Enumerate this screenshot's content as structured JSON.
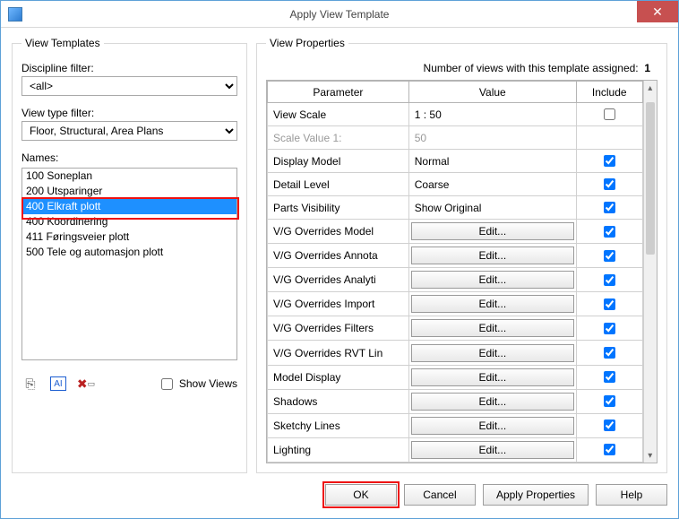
{
  "window": {
    "title": "Apply View Template"
  },
  "left": {
    "group_label": "View Templates",
    "discipline_label": "Discipline filter:",
    "discipline_value": "<all>",
    "viewtype_label": "View type filter:",
    "viewtype_value": "Floor, Structural, Area Plans",
    "names_label": "Names:",
    "names": [
      {
        "text": "100 Soneplan",
        "selected": false
      },
      {
        "text": "200 Utsparinger",
        "selected": false
      },
      {
        "text": "400 Elkraft plott",
        "selected": true
      },
      {
        "text": "400 Koordinering",
        "selected": false
      },
      {
        "text": "411 Føringsveier plott",
        "selected": false
      },
      {
        "text": "500 Tele og automasjon plott",
        "selected": false
      }
    ],
    "show_views_label": "Show Views"
  },
  "right": {
    "group_label": "View Properties",
    "assigned_prefix": "Number of views with this template assigned:",
    "assigned_count": "1",
    "columns": {
      "parameter": "Parameter",
      "value": "Value",
      "include": "Include"
    },
    "edit_label": "Edit...",
    "rows": [
      {
        "param": "View Scale",
        "value_text": "1 : 50",
        "edit": false,
        "include": false,
        "disabled": false
      },
      {
        "param": "Scale Value    1:",
        "value_text": "50",
        "edit": false,
        "include": null,
        "disabled": true
      },
      {
        "param": "Display Model",
        "value_text": "Normal",
        "edit": false,
        "include": true,
        "disabled": false
      },
      {
        "param": "Detail Level",
        "value_text": "Coarse",
        "edit": false,
        "include": true,
        "disabled": false
      },
      {
        "param": "Parts Visibility",
        "value_text": "Show Original",
        "edit": false,
        "include": true,
        "disabled": false
      },
      {
        "param": "V/G Overrides Model",
        "value_text": "",
        "edit": true,
        "include": true,
        "disabled": false
      },
      {
        "param": "V/G Overrides Annota",
        "value_text": "",
        "edit": true,
        "include": true,
        "disabled": false
      },
      {
        "param": "V/G Overrides Analyti",
        "value_text": "",
        "edit": true,
        "include": true,
        "disabled": false
      },
      {
        "param": "V/G Overrides Import",
        "value_text": "",
        "edit": true,
        "include": true,
        "disabled": false
      },
      {
        "param": "V/G Overrides Filters",
        "value_text": "",
        "edit": true,
        "include": true,
        "disabled": false
      },
      {
        "param": "V/G Overrides RVT Lin",
        "value_text": "",
        "edit": true,
        "include": true,
        "disabled": false
      },
      {
        "param": "Model Display",
        "value_text": "",
        "edit": true,
        "include": true,
        "disabled": false
      },
      {
        "param": "Shadows",
        "value_text": "",
        "edit": true,
        "include": true,
        "disabled": false
      },
      {
        "param": "Sketchy Lines",
        "value_text": "",
        "edit": true,
        "include": true,
        "disabled": false
      },
      {
        "param": "Lighting",
        "value_text": "",
        "edit": true,
        "include": true,
        "disabled": false
      }
    ]
  },
  "footer": {
    "ok": "OK",
    "cancel": "Cancel",
    "apply": "Apply Properties",
    "help": "Help"
  }
}
